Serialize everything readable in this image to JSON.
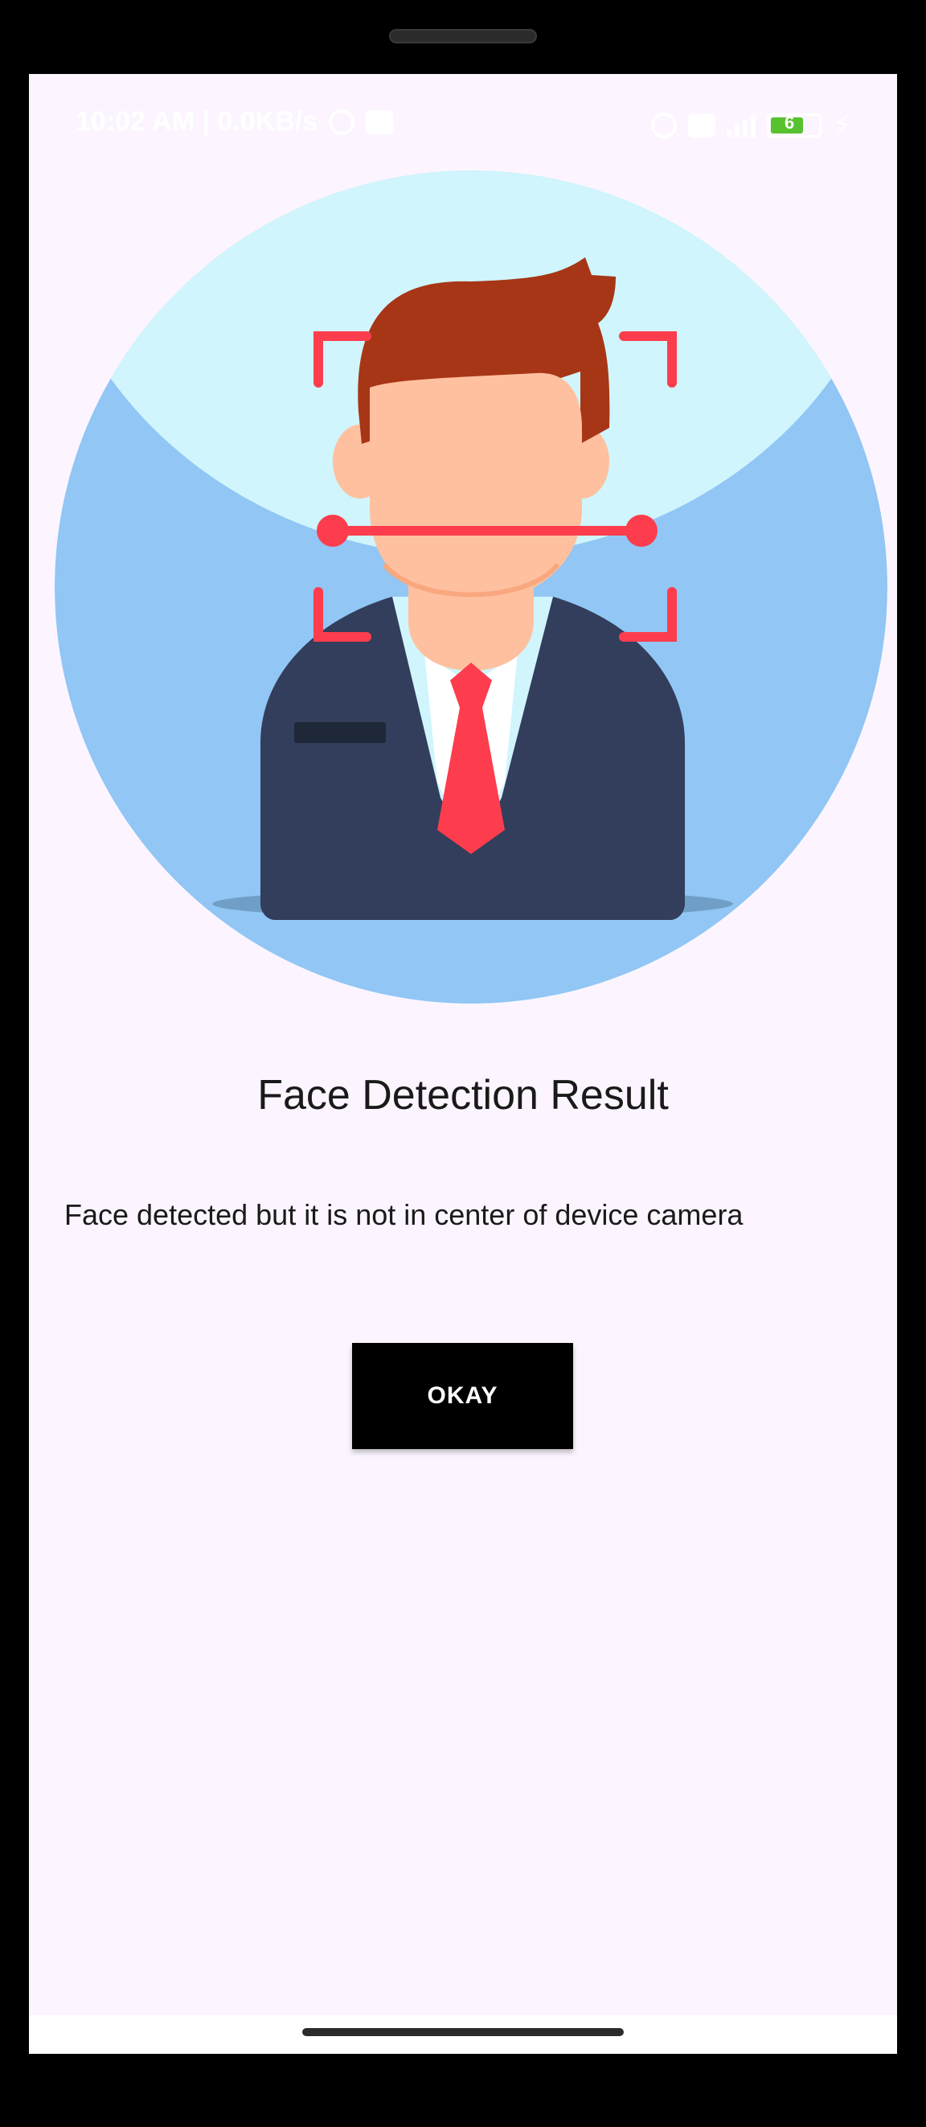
{
  "status_bar": {
    "time_and_speed": "10:02 AM | 0.0KB/s",
    "battery_level": "6"
  },
  "illustration": {
    "icon": "face-detection-person-icon",
    "colors": {
      "background_circle": "#91c6f5",
      "head_halo": "#d0f5fc",
      "scan_frame": "#fd3d4d",
      "hair": "#a73616",
      "skin": "#ffc09f",
      "suit": "#323e5b",
      "tie": "#fd3d4d"
    }
  },
  "dialog": {
    "title": "Face Detection Result",
    "message": "Face detected but it is not in center of device camera",
    "button_label": "OKAY"
  },
  "colors": {
    "screen_background": "#fcf5ff",
    "button_background": "#000000",
    "button_text": "#ffffff"
  }
}
